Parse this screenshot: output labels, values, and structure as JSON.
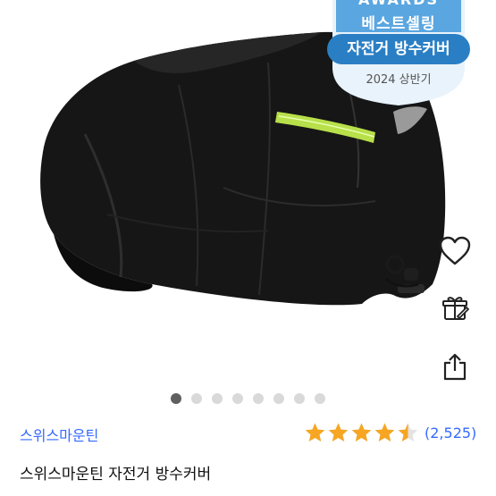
{
  "badge": {
    "line1": "AWARDS",
    "line2": "베스트셀링",
    "category": "자전거 방수커버",
    "period": "2024 상반기"
  },
  "actions": {
    "wishlist_icon": "heart-outline-icon",
    "gift_icon": "gift-icon",
    "share_icon": "share-icon"
  },
  "pager": {
    "count": 8,
    "active_index": 0
  },
  "product": {
    "brand": "스위스마운틴",
    "title": "스위스마운틴 자전거 방수커버",
    "rating": 4.5,
    "review_count": "(2,525)"
  },
  "colors": {
    "link": "#346aff",
    "star": "#f6a623",
    "badge_blue": "#2a7fc4",
    "cover_black": "#161616",
    "reflective_stripe": "#b8e04a"
  }
}
